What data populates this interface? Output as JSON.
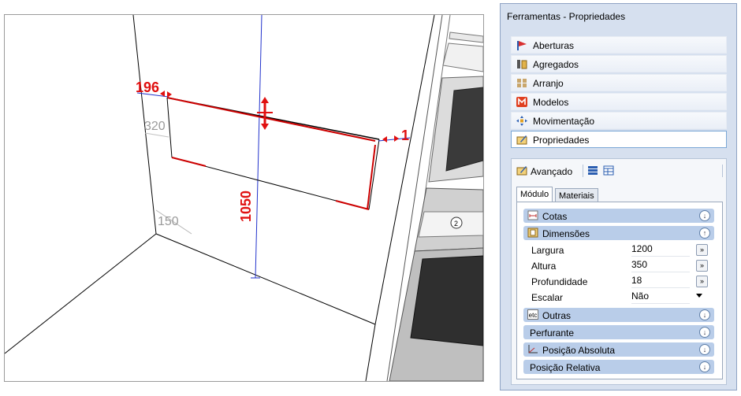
{
  "viewport": {
    "dims": {
      "d196": "196",
      "d1": "1",
      "d1050": "1050",
      "g320": "320",
      "g150": "150"
    },
    "oven_knob_label": "2"
  },
  "panel": {
    "title": "Ferramentas - Propriedades",
    "menu": [
      {
        "label": "Aberturas",
        "icon": "flag-icon"
      },
      {
        "label": "Agregados",
        "icon": "aggregates-icon"
      },
      {
        "label": "Arranjo",
        "icon": "arrange-icon"
      },
      {
        "label": "Modelos",
        "icon": "models-icon"
      },
      {
        "label": "Movimentação",
        "icon": "move-icon"
      },
      {
        "label": "Propriedades",
        "icon": "properties-icon",
        "selected": true
      }
    ],
    "toolbar": {
      "label": "Avançado",
      "icon": "advanced-icon"
    },
    "tabs": [
      {
        "label": "Módulo",
        "active": true
      },
      {
        "label": "Materiais"
      }
    ],
    "sections": {
      "cotas": "Cotas",
      "dimensoes": "Dimensões",
      "outras": "Outras",
      "perfurante": "Perfurante",
      "posicao_absoluta": "Posição Absoluta",
      "posicao_relativa": "Posição Relativa"
    },
    "icon_text": {
      "outras": "etc"
    },
    "props": {
      "largura": {
        "label": "Largura",
        "value": "1200"
      },
      "altura": {
        "label": "Altura",
        "value": "350"
      },
      "profundidade": {
        "label": "Profundidade",
        "value": "18"
      },
      "escalar": {
        "label": "Escalar",
        "value": "Não"
      }
    },
    "colors": {
      "section_bar": "#b9cde9",
      "panel_bg": "#d6e0ef",
      "dimension_red": "#e01010"
    }
  }
}
